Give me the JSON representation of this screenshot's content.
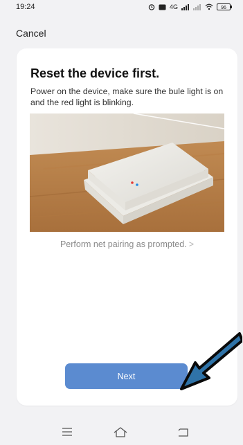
{
  "status_bar": {
    "time": "19:24",
    "network": "4G",
    "battery": "96"
  },
  "header": {
    "cancel_label": "Cancel"
  },
  "card": {
    "title": "Reset the device first.",
    "description": "Power on the device, make sure the bule light is on and the red light is blinking.",
    "pair_link": "Perform net pairing as prompted.",
    "pair_chevron": ">",
    "next_label": "Next"
  },
  "colors": {
    "accent": "#5b8bd0",
    "background": "#f2f2f4",
    "card": "#ffffff",
    "arrow_fill": "#2f73a8"
  },
  "icons": {
    "nav_menu": "menu-icon",
    "nav_home": "home-icon",
    "nav_back": "back-icon"
  }
}
